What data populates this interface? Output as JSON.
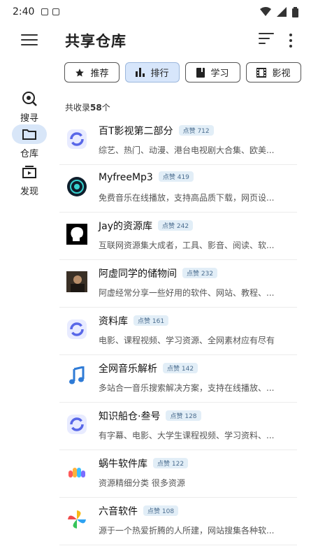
{
  "status_bar": {
    "time": "2:40"
  },
  "app_bar": {
    "title": "共享仓库"
  },
  "chips": [
    {
      "label": "推荐",
      "icon": "star-icon"
    },
    {
      "label": "排行",
      "icon": "bar-chart-icon",
      "selected": true
    },
    {
      "label": "学习",
      "icon": "book-icon"
    },
    {
      "label": "影视",
      "icon": "film-icon"
    }
  ],
  "nav": [
    {
      "label": "搜寻",
      "icon": "search-globe-icon"
    },
    {
      "label": "仓库",
      "icon": "folder-icon",
      "active": true
    },
    {
      "label": "发现",
      "icon": "tv-icon"
    }
  ],
  "count": {
    "prefix": "共收录",
    "value": "58",
    "suffix": "个"
  },
  "badge_prefix": "点赞",
  "items": [
    {
      "name": "百T影视第二部分",
      "likes": "712",
      "desc": "综艺、热门、动漫、港台电视剧大合集、欧美...",
      "logo": "refresh-app-icon"
    },
    {
      "name": "MyfreeMp3",
      "likes": "419",
      "desc": "免费音乐在线播放，支持高品质下载，网页设...",
      "logo": "myfreemp3-icon"
    },
    {
      "name": "Jay的资源库",
      "likes": "242",
      "desc": "互联网资源集大成者，工具、影音、阅读、软...",
      "logo": "jay-head-icon"
    },
    {
      "name": "阿虚同学的储物间",
      "likes": "232",
      "desc": "阿虚经常分享一些好用的软件、网站、教程、...",
      "logo": "photo-avatar-icon"
    },
    {
      "name": "资料库",
      "likes": "161",
      "desc": "电影、课程视频、学习资源、全网素材应有尽有",
      "logo": "refresh-app-icon"
    },
    {
      "name": "全网音乐解析",
      "likes": "142",
      "desc": "多站合一音乐搜索解决方案，支持在线播放、...",
      "logo": "music-note-icon"
    },
    {
      "name": "知识船仓·叁号",
      "likes": "128",
      "desc": "有字幕、电影、大学生课程视频、学习资料、...",
      "logo": "refresh-app-icon"
    },
    {
      "name": "蜗牛软件库",
      "likes": "122",
      "desc": "资源精细分类 很多资源",
      "logo": "cloud-logo-icon"
    },
    {
      "name": "六音软件",
      "likes": "108",
      "desc": "源于一个热爱折腾的人所建，网站搜集各种软...",
      "logo": "pinwheel-logo-icon"
    }
  ]
}
